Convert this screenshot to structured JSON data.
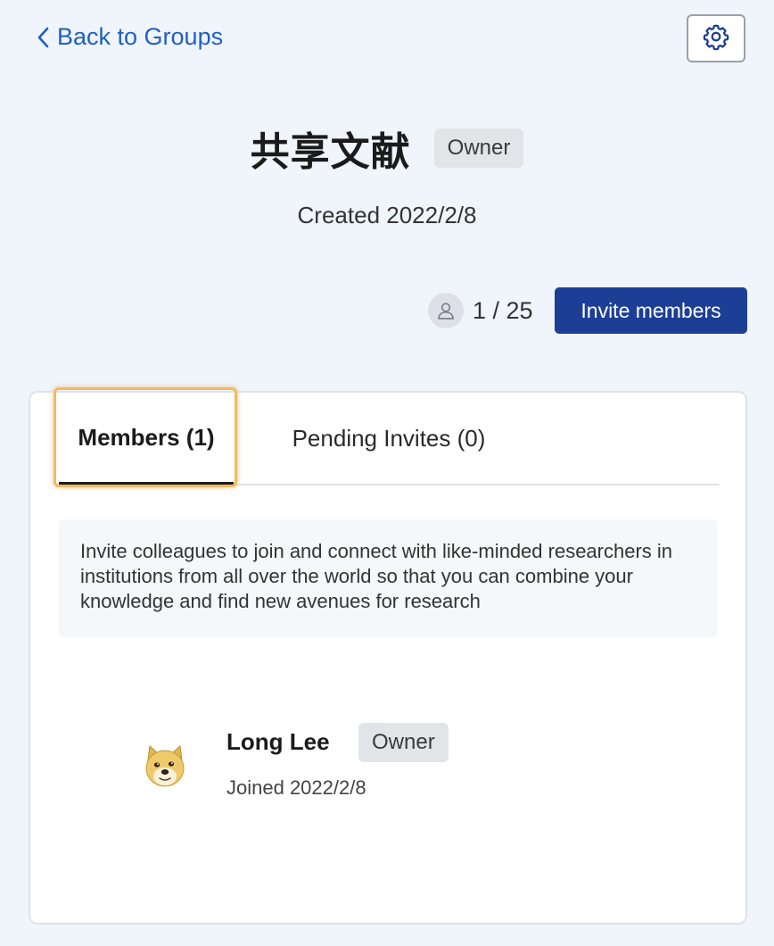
{
  "header": {
    "back_label": "Back to Groups",
    "back_icon": "chevron-left-icon",
    "settings_icon": "gear-icon"
  },
  "group": {
    "title": "共享文献",
    "role_badge": "Owner",
    "created": "Created 2022/2/8",
    "member_count": "1 / 25",
    "invite_label": "Invite members"
  },
  "tabs": [
    {
      "label": "Members (1)",
      "active": true
    },
    {
      "label": "Pending Invites (0)",
      "active": false
    }
  ],
  "info_text": "Invite colleagues to join and connect with like-minded researchers in institutions from all over the world so that you can combine your knowledge and find new avenues for research",
  "members": [
    {
      "name": "Long Lee",
      "role": "Owner",
      "joined": "Joined 2022/2/8",
      "avatar_icon": "doge-avatar-icon"
    }
  ],
  "colors": {
    "background": "#f0f5fc",
    "link": "#1f5fc4",
    "primary_button": "#1c3f95",
    "focus_ring": "#f2b862",
    "badge_bg": "#e2e4e8"
  }
}
